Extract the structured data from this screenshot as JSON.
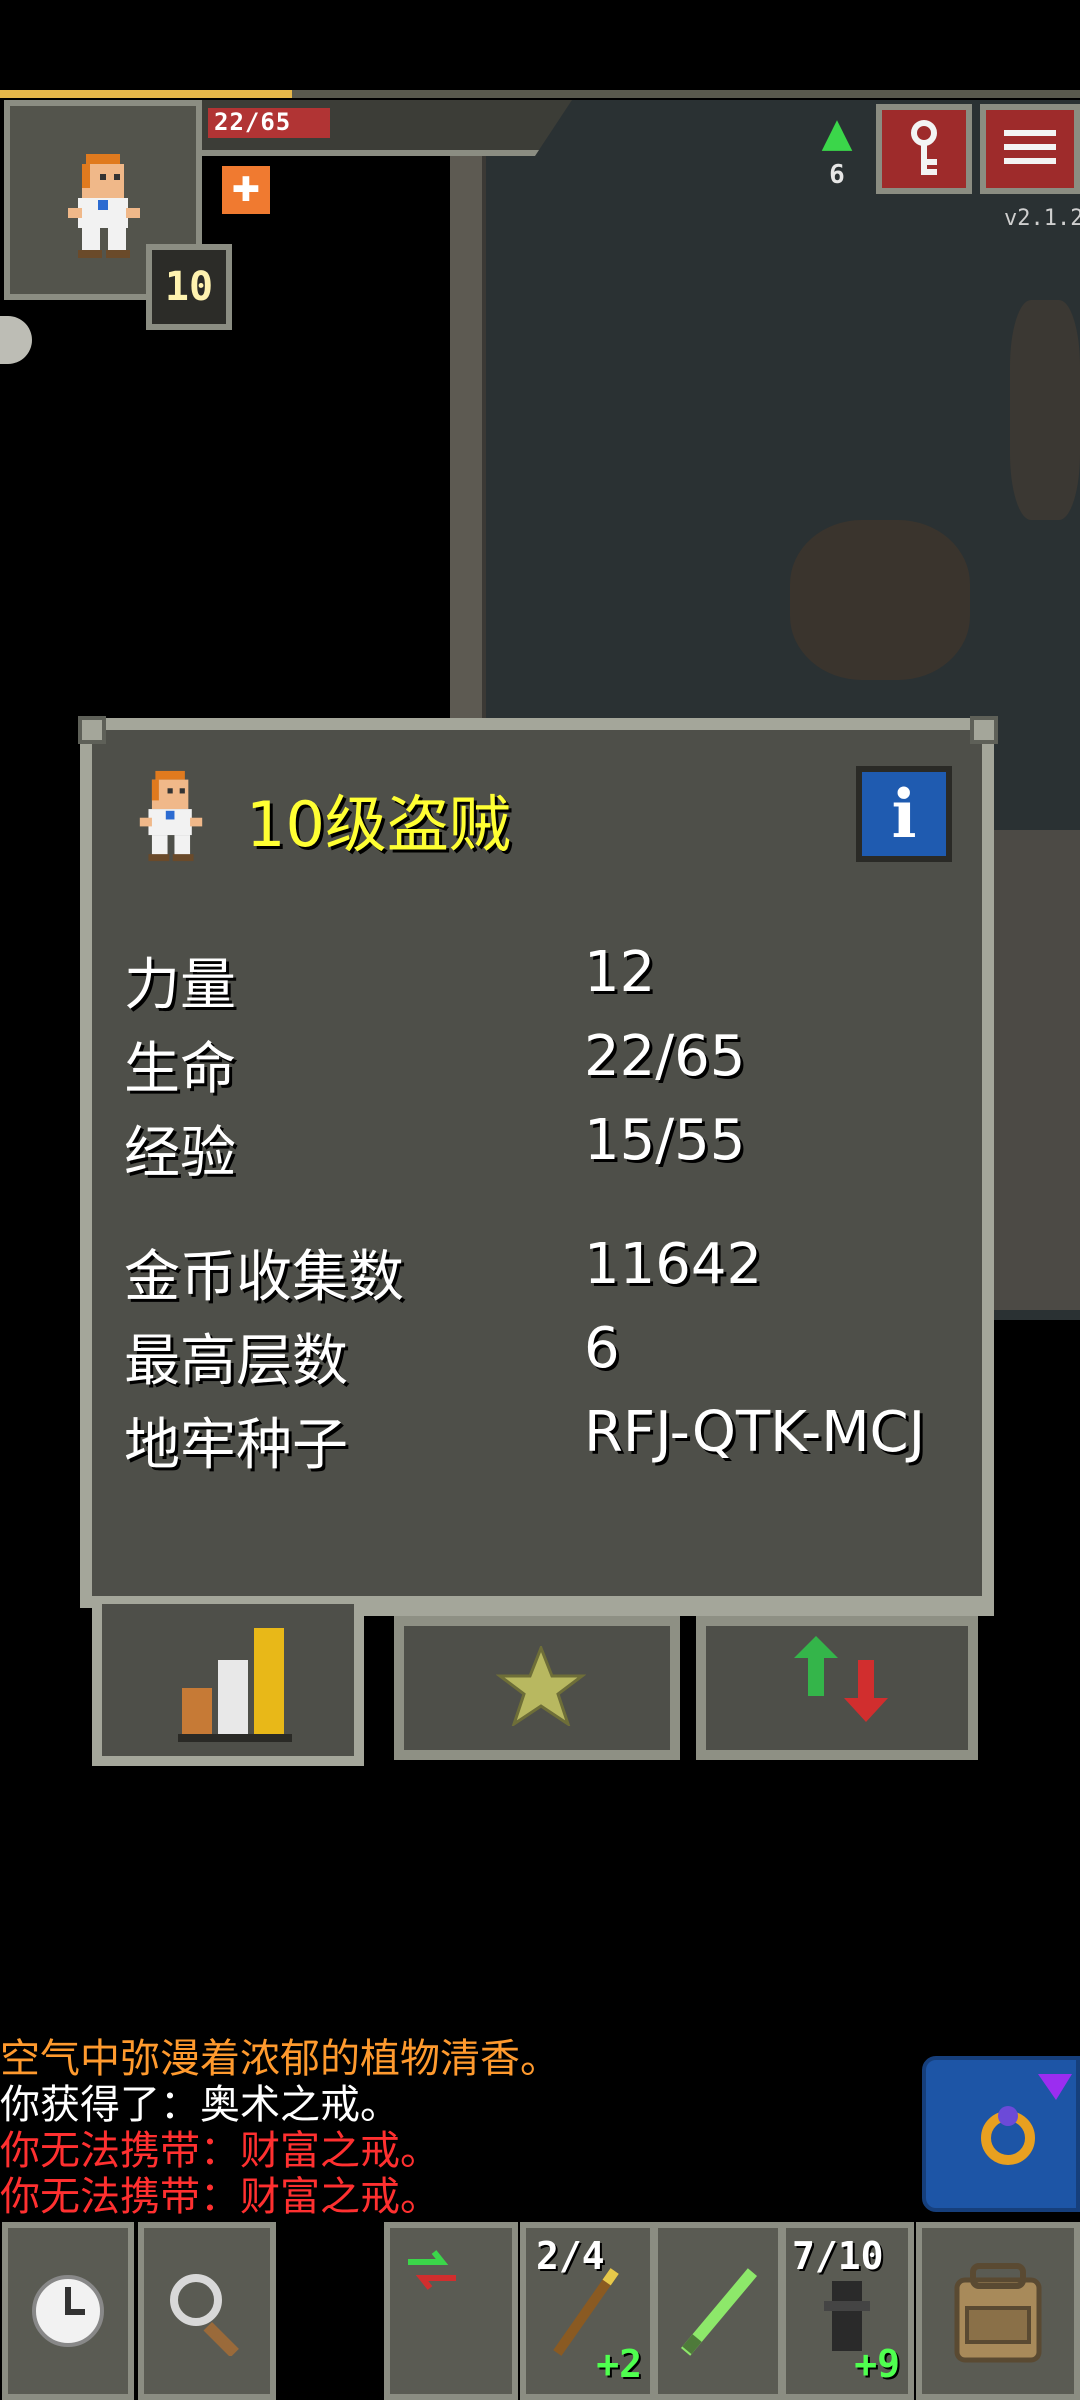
{
  "hud": {
    "hp_text": "22/65",
    "hp_fraction": 0.34,
    "xp_fraction": 0.27,
    "level": "10",
    "depth": "6",
    "version": "v2.1.2"
  },
  "dialog": {
    "title": "10级盗贼",
    "info_icon": "i",
    "stats": [
      {
        "label": "力量",
        "value": "12"
      },
      {
        "label": "生命",
        "value": "22/65"
      },
      {
        "label": "经验",
        "value": "15/55"
      }
    ],
    "stats2": [
      {
        "label": "金币收集数",
        "value": "11642"
      },
      {
        "label": "最高层数",
        "value": "6"
      },
      {
        "label": "地牢种子",
        "value": "RFJ-QTK-MCJ"
      }
    ],
    "tabs": [
      "stats-tab",
      "badges-tab",
      "buffs-tab"
    ]
  },
  "log": [
    {
      "text": "空气中弥漫着浓郁的植物清香。",
      "color": "orange"
    },
    {
      "text": "你获得了：奥术之戒。",
      "color": "white"
    },
    {
      "text": "你无法携带：财富之戒。",
      "color": "red"
    },
    {
      "text": "你无法携带：财富之戒。",
      "color": "red"
    }
  ],
  "toolbar": {
    "slot1_count": "2/4",
    "slot1_plus": "+2",
    "slot3_count": "7/10",
    "slot3_plus": "+9"
  },
  "colors": {
    "title": "#ffff33",
    "log_orange": "#ff9a2e",
    "log_red": "#ff3030",
    "hp": "#b13434",
    "accent_blue": "#1f5bb0"
  }
}
